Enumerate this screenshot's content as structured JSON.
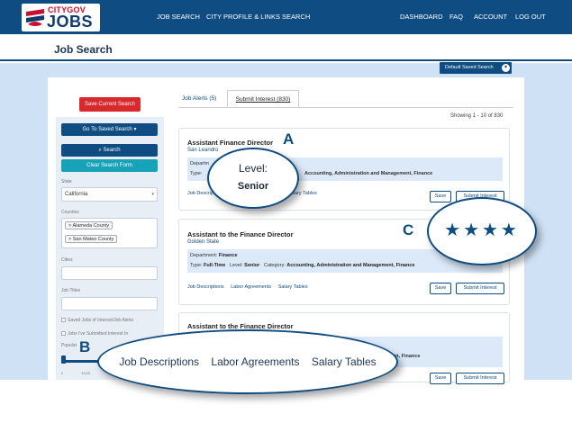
{
  "brand": {
    "logo_top": "CITYGOV",
    "logo_big": "JOBS",
    "logo_colors": {
      "red": "#c8102e",
      "navy": "#0f3b6b"
    }
  },
  "nav": {
    "left": [
      "JOB SEARCH",
      "CITY PROFILE & LINKS SEARCH"
    ],
    "right": [
      "DASHBOARD",
      "FAQ",
      "ACCOUNT",
      "LOG OUT"
    ]
  },
  "page_title": "Job Search",
  "saved_search_dropdown": "Default Saved Search",
  "sidebar": {
    "save_button": "Save Current Search",
    "goto_saved_button": "Go To Saved Search",
    "goto_saved_chevron": "▾",
    "search_button": "Search",
    "search_icon": "search-icon",
    "clear_button": "Clear Search Form",
    "state_label": "State",
    "state_value": "California",
    "counties_label": "Counties",
    "counties": [
      "Alameda County",
      "San Mateo County"
    ],
    "chip_remove": "×",
    "cities_label": "Cities",
    "job_titles_label": "Job Titles",
    "check_saved": "Saved Jobs of Interest/Job Alerts",
    "check_submitted": "Jobs I've Submitted Interest In",
    "population_label": "Populat",
    "slider_ticks": [
      "0",
      "10,00"
    ]
  },
  "tabs": {
    "alerts": "Job Alerts (5)",
    "submit_interest": "Submit Interest (830)"
  },
  "showing": "Showing 1 - 10 of 830",
  "jobs": [
    {
      "title": "Assistant Finance Director",
      "location": "San Leandro",
      "department_label": "Departm",
      "type_label": "Type:",
      "category": "Accounting, Administration and Management, Finance",
      "links": [
        "Job Descrip",
        "Salary Tables"
      ],
      "save": "Save",
      "submit": "Submit Interest"
    },
    {
      "title": "Assistant to the Finance Director",
      "location": "Golden State",
      "department_label": "Department:",
      "department": "Finance",
      "type_label": "Type:",
      "type": "Full-Time",
      "level_label": "Level:",
      "level": "Senior",
      "category_label": "Category:",
      "category": "Accounting, Administration and Management, Finance",
      "links": [
        "Job Descriptions",
        "Labor Agreements",
        "Salary Tables"
      ],
      "save": "Save",
      "submit": "Submit Interest"
    },
    {
      "title": "Assistant to the Finance Director",
      "category_tail": "agement, Finance",
      "save": "Save",
      "submit": "Submit Interest"
    }
  ],
  "callouts": {
    "a": {
      "letter": "A",
      "line1": "Level:",
      "line2": "Senior"
    },
    "b": {
      "letter": "B",
      "links": [
        "Job Descriptions",
        "Labor Agreements",
        "Salary Tables"
      ]
    },
    "c": {
      "letter": "C",
      "stars": "★★★★",
      "rating": 4
    }
  }
}
